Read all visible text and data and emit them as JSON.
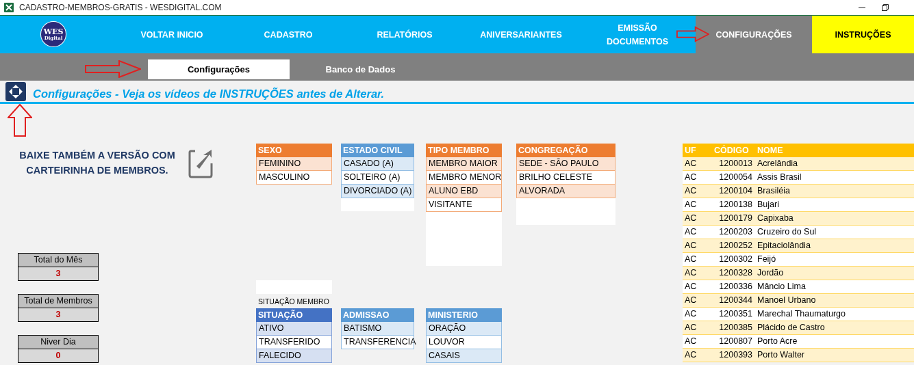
{
  "window": {
    "title": "CADASTRO-MEMBROS-GRATIS - WESDIGITAL.COM"
  },
  "logo": {
    "line_1": "WES",
    "line_2": "Digital"
  },
  "nav": [
    {
      "label": "VOLTAR INICIO",
      "kind": "link",
      "selected": false
    },
    {
      "label": "CADASTRO",
      "kind": "link",
      "selected": false
    },
    {
      "label": "RELATÓRIOS",
      "kind": "link",
      "selected": false
    },
    {
      "label": "ANIVERSARIANTES",
      "kind": "link",
      "selected": false
    },
    {
      "label": "EMISSÃO DOCUMENTOS",
      "kind": "link",
      "selected": false
    },
    {
      "label": "CONFIGURAÇÕES",
      "kind": "link",
      "selected": true
    },
    {
      "label": "INSTRUÇÕES",
      "kind": "highlight",
      "selected": false
    }
  ],
  "tabs": [
    {
      "label": "Configurações",
      "selected": true
    },
    {
      "label": "Banco de Dados",
      "selected": false
    }
  ],
  "heading": "Configurações  - Veja os vídeos de INSTRUÇÕES antes de Alterar.",
  "promo": "BAIXE TAMBÉM A VERSÃO COM CARTEIRINHA DE MEMBROS.",
  "stats": [
    {
      "label": "Total do Mês",
      "value": "3"
    },
    {
      "label": "Total de Membros",
      "value": "3"
    },
    {
      "label": "Niver Dia",
      "value": "0"
    }
  ],
  "caption": "SITUAÇÃO MEMBRO",
  "lists": [
    {
      "header": "SEXO",
      "color": "#ed7d31",
      "items": [
        "FEMININO",
        "MASCULINO"
      ]
    },
    {
      "header": "ESTADO CIVIL",
      "color": "#5b9bd5",
      "items": [
        "CASADO (A)",
        "SOLTEIRO (A)",
        "DIVORCIADO (A)"
      ]
    },
    {
      "header": "TIPO MEMBRO",
      "color": "#ed7d31",
      "items": [
        "MEMBRO MAIOR",
        "MEMBRO MENOR",
        "ALUNO EBD",
        "VISITANTE"
      ]
    },
    {
      "header": "CONGREGAÇÃO",
      "color": "#ed7d31",
      "items": [
        "SEDE - SÃO PAULO",
        "BRILHO CELESTE",
        "ALVORADA"
      ]
    },
    {
      "header": "SITUAÇÃO",
      "color": "#4472c4",
      "items": [
        "ATIVO",
        "TRANSFERIDO",
        "FALECIDO"
      ]
    },
    {
      "header": "ADMISSAO",
      "color": "#5b9bd5",
      "items": [
        "BATISMO",
        "TRANSFERENCIA"
      ]
    },
    {
      "header": "MINISTERIO",
      "color": "#5b9bd5",
      "items": [
        "ORAÇÃO",
        "LOUVOR",
        "CASAIS"
      ]
    }
  ],
  "cities": {
    "columns": [
      "UF",
      "CÓDIGO",
      "NOME"
    ],
    "rows": [
      [
        "AC",
        "1200013",
        "Acrelândia"
      ],
      [
        "AC",
        "1200054",
        "Assis Brasil"
      ],
      [
        "AC",
        "1200104",
        "Brasiléia"
      ],
      [
        "AC",
        "1200138",
        "Bujari"
      ],
      [
        "AC",
        "1200179",
        "Capixaba"
      ],
      [
        "AC",
        "1200203",
        "Cruzeiro do Sul"
      ],
      [
        "AC",
        "1200252",
        "Epitaciolândia"
      ],
      [
        "AC",
        "1200302",
        "Feijó"
      ],
      [
        "AC",
        "1200328",
        "Jordão"
      ],
      [
        "AC",
        "1200336",
        "Mâncio Lima"
      ],
      [
        "AC",
        "1200344",
        "Manoel Urbano"
      ],
      [
        "AC",
        "1200351",
        "Marechal Thaumaturgo"
      ],
      [
        "AC",
        "1200385",
        "Plácido de Castro"
      ],
      [
        "AC",
        "1200807",
        "Porto Acre"
      ],
      [
        "AC",
        "1200393",
        "Porto Walter"
      ]
    ]
  }
}
